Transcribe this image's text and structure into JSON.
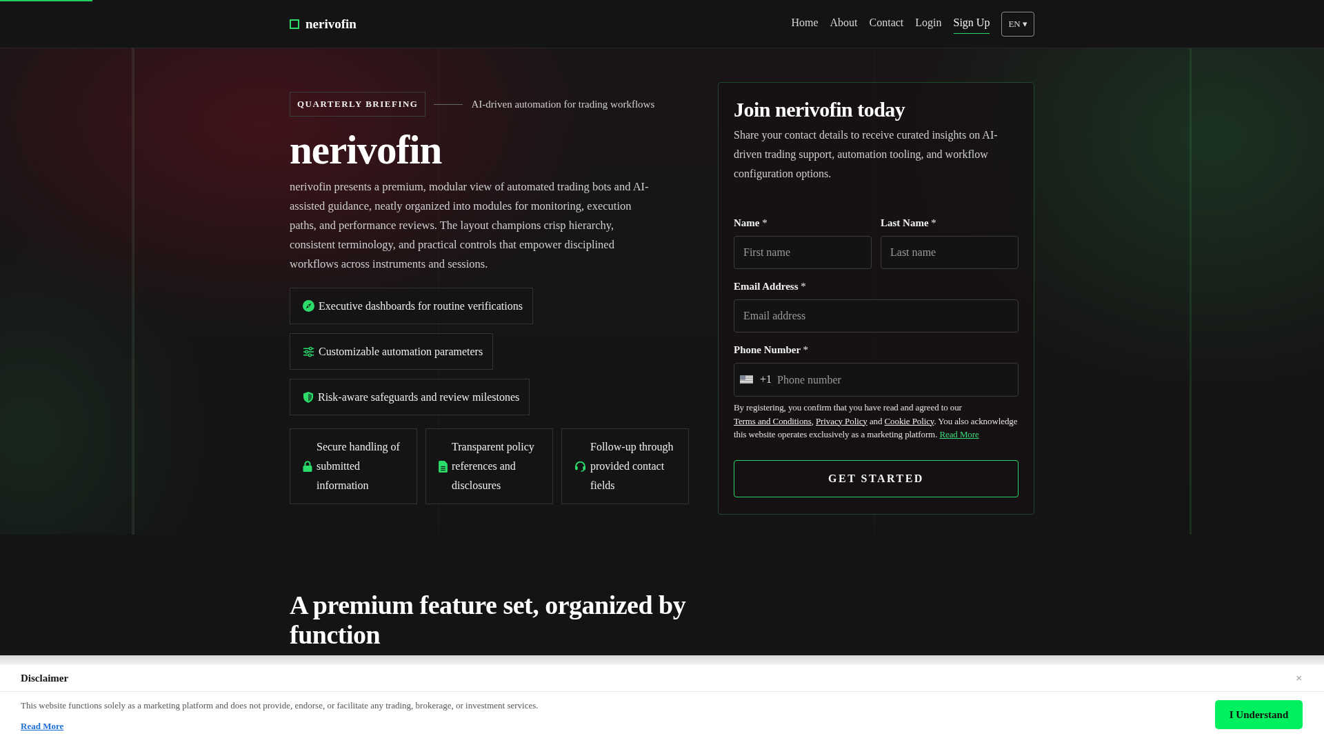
{
  "page_progress": {
    "level": 0.07
  },
  "header": {
    "logo": "nerivofin",
    "nav": [
      {
        "label": "Home",
        "selected": false
      },
      {
        "label": "About",
        "selected": false
      },
      {
        "label": "Contact",
        "selected": false
      },
      {
        "label": "Login",
        "selected": false
      },
      {
        "label": "Sign Up",
        "selected": true
      }
    ],
    "language": "EN ▾"
  },
  "hero": {
    "badge": "QUARTERLY BRIEFING",
    "tagline": "AI-driven automation for trading workflows",
    "title": "nerivofin",
    "description": "nerivofin presents a premium, modular view of automated trading bots and AI-assisted guidance, neatly organized into modules for monitoring, execution paths, and performance reviews. The layout champions crisp hierarchy, consistent terminology, and practical controls that empower disciplined workflows across instruments and sessions.",
    "features": [
      "Executive dashboards for routine verifications",
      "Customizable automation parameters",
      "Risk-aware safeguards and review milestones"
    ],
    "cards": [
      "Secure handling of submitted information",
      "Transparent policy references and disclosures",
      "Follow-up through provided contact fields"
    ]
  },
  "signup_form": {
    "title": "Join nerivofin today",
    "description": "Share your contact details to receive curated insights on AI-driven trading support, automation tooling, and workflow configuration options.",
    "fields": [
      {
        "kind": "half",
        "label": "Name",
        "required_mark": "*",
        "placeholder": "First name"
      },
      {
        "kind": "half",
        "label": "Last Name",
        "required_mark": "*",
        "placeholder": "Last name"
      },
      {
        "kind": "full",
        "label": "Email Address",
        "required_mark": "*",
        "placeholder": "Email address"
      },
      {
        "kind": "phone",
        "label": "Phone Number",
        "required_mark": "*",
        "dial_code": "+1",
        "placeholder": "Phone number"
      }
    ],
    "consent": [
      {
        "kind": "text",
        "text": "By registering, you confirm that you have read and agreed to our "
      },
      {
        "kind": "link",
        "text": "Terms and Conditions"
      },
      {
        "kind": "text",
        "text": ", "
      },
      {
        "kind": "link",
        "text": "Privacy Policy"
      },
      {
        "kind": "text",
        "text": " and "
      },
      {
        "kind": "link",
        "text": "Cookie Policy"
      },
      {
        "kind": "text",
        "text": ". You also acknowledge this website operates exclusively as a marketing platform. "
      },
      {
        "kind": "accent_link",
        "text": "Read More"
      }
    ],
    "submit": "GET STARTED"
  },
  "features_section": {
    "title": "A premium feature set, organized by function"
  },
  "disclaimer": {
    "title": "Disclaimer",
    "close": "×",
    "text": "This website functions solely as a marketing platform and does not provide, endorse, or facilitate any trading, brokerage, or investment services.",
    "link": "Read More",
    "button": "I Understand"
  }
}
